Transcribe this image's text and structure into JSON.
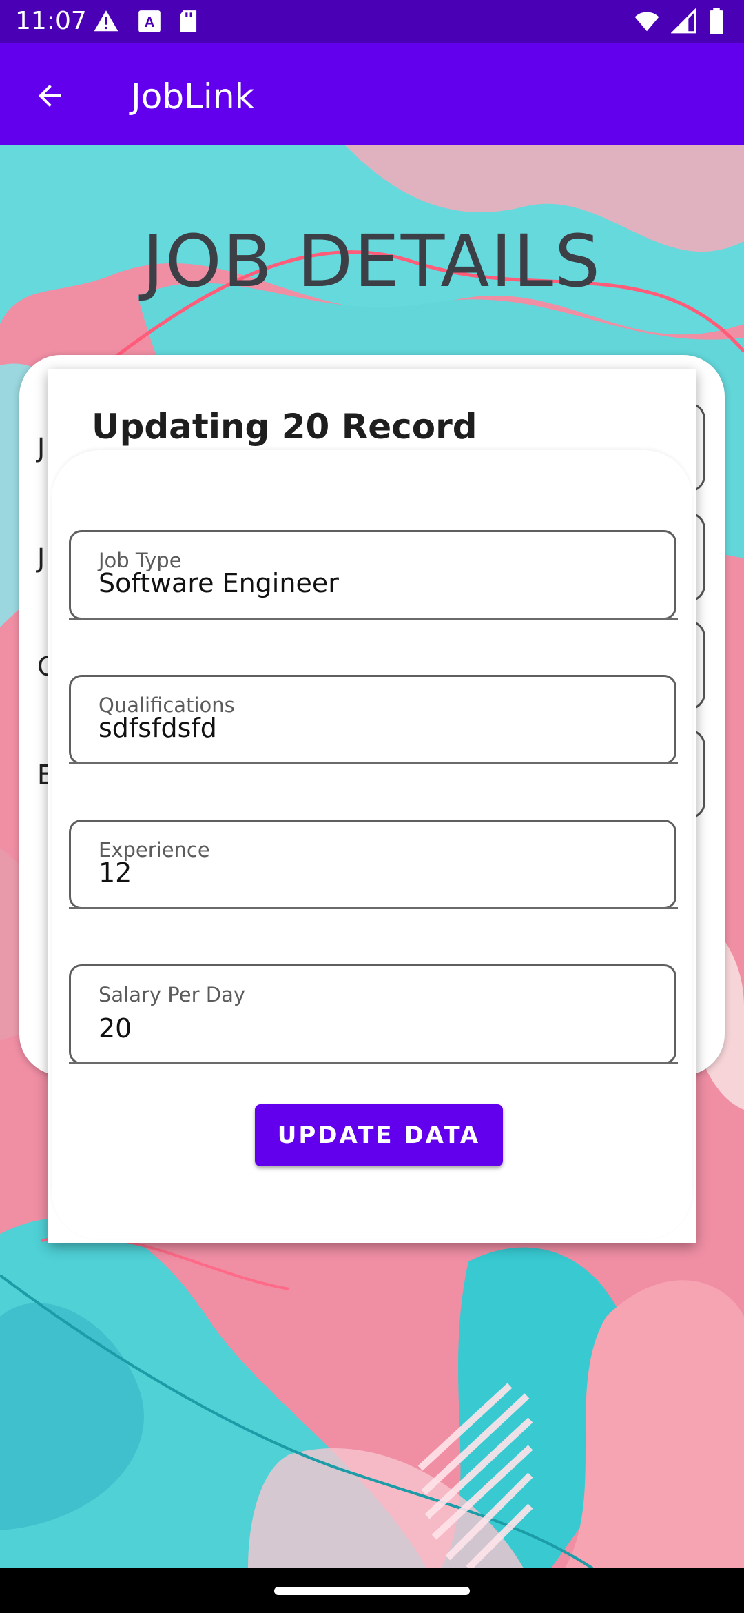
{
  "status_bar": {
    "time": "11:07",
    "icons": [
      "alert-icon",
      "a-icon",
      "sd-card-icon",
      "wifi-icon",
      "signal-icon",
      "battery-icon"
    ]
  },
  "app_bar": {
    "title": "JobLink",
    "back_icon": "arrow-back-icon",
    "color": "#6200ee"
  },
  "page": {
    "heading": "JOB DETAILS",
    "background_fields_initials": [
      "J",
      "J",
      "C",
      "E"
    ]
  },
  "dialog": {
    "title": "Updating 20 Record",
    "fields": [
      {
        "label": "Job Type",
        "value": "Software Engineer"
      },
      {
        "label": "Qualifications",
        "value": "sdfsfdsfd"
      },
      {
        "label": "Experience",
        "value": "12"
      },
      {
        "label": "Salary Per Day",
        "value": "20"
      }
    ],
    "button_label": "UPDATE DATA"
  },
  "colors": {
    "status_bar": "#4a00b5",
    "accent": "#6200ee",
    "background_pink": "#f48aa0",
    "background_teal": "#4fd9d9"
  }
}
